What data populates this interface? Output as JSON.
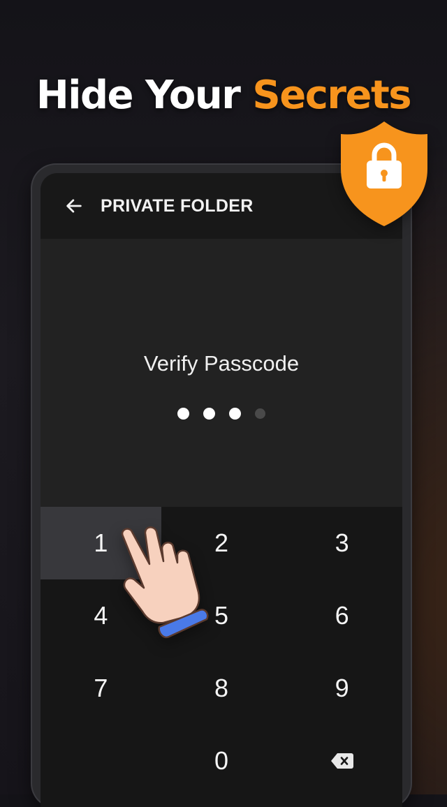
{
  "headline": {
    "prefix": "Hide Your ",
    "accent": "Secrets"
  },
  "colors": {
    "accent": "#f7941d",
    "background": "#18171c",
    "screen": "#222222",
    "keypad": "#161616",
    "sleeve": "#4a7ae8"
  },
  "badge": {
    "icon": "lock-shield-icon"
  },
  "appbar": {
    "back_icon": "arrow-left-icon",
    "title": "PRIVATE FOLDER"
  },
  "passcode": {
    "prompt": "Verify Passcode",
    "digits_entered": 3,
    "length": 4
  },
  "keypad": {
    "keys": [
      "1",
      "2",
      "3",
      "4",
      "5",
      "6",
      "7",
      "8",
      "9",
      "",
      "0",
      "⌫"
    ],
    "pressed_key": "1",
    "delete_icon": "backspace-icon"
  },
  "overlay": {
    "icon": "pointing-hand-icon"
  }
}
